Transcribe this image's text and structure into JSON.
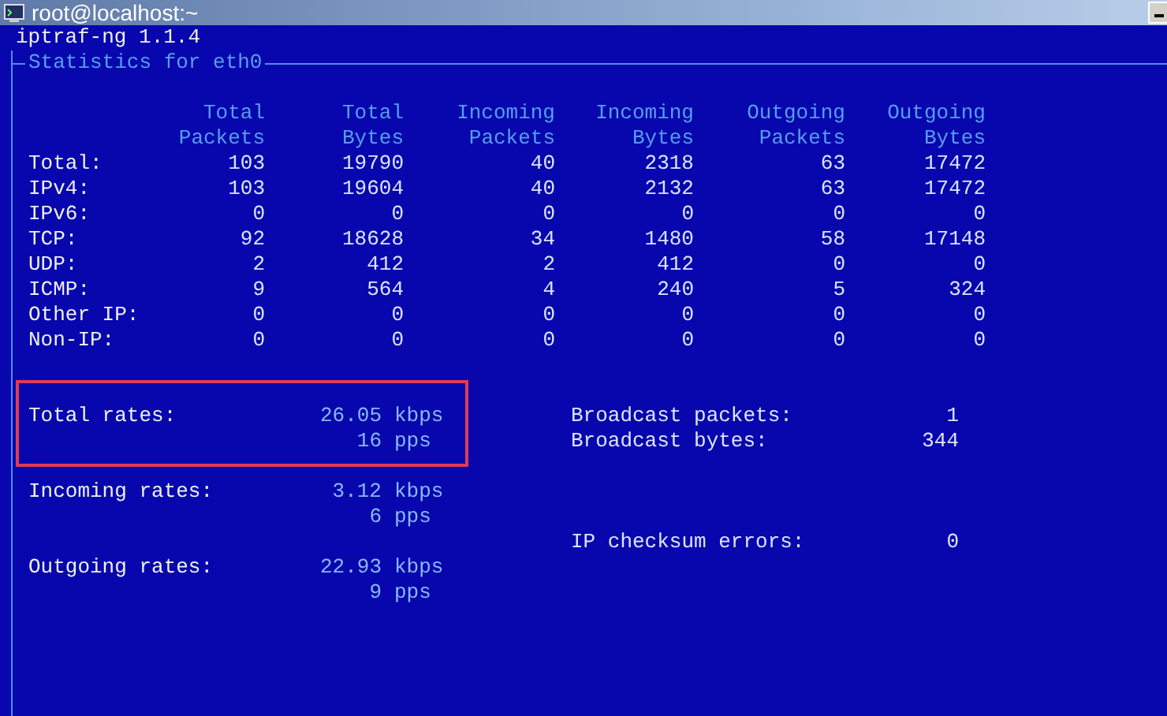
{
  "window": {
    "title": "root@localhost:~"
  },
  "terminal": {
    "app_title": "iptraf-ng 1.1.4",
    "panel_title": "Statistics for eth0",
    "table": {
      "columns": [
        "Total Packets",
        "Total Bytes",
        "Incoming Packets",
        "Incoming Bytes",
        "Outgoing Packets",
        "Outgoing Bytes"
      ],
      "rows": [
        {
          "label": "Total:",
          "cells": [
            "103",
            "19790",
            "40",
            "2318",
            "63",
            "17472"
          ]
        },
        {
          "label": "IPv4:",
          "cells": [
            "103",
            "19604",
            "40",
            "2132",
            "63",
            "17472"
          ]
        },
        {
          "label": "IPv6:",
          "cells": [
            "0",
            "0",
            "0",
            "0",
            "0",
            "0"
          ]
        },
        {
          "label": "TCP:",
          "cells": [
            "92",
            "18628",
            "34",
            "1480",
            "58",
            "17148"
          ]
        },
        {
          "label": "UDP:",
          "cells": [
            "2",
            "412",
            "2",
            "412",
            "0",
            "0"
          ]
        },
        {
          "label": "ICMP:",
          "cells": [
            "9",
            "564",
            "4",
            "240",
            "5",
            "324"
          ]
        },
        {
          "label": "Other IP:",
          "cells": [
            "0",
            "0",
            "0",
            "0",
            "0",
            "0"
          ]
        },
        {
          "label": "Non-IP:",
          "cells": [
            "0",
            "0",
            "0",
            "0",
            "0",
            "0"
          ]
        }
      ]
    },
    "rates": [
      {
        "label": "Total rates:",
        "highlighted": true,
        "lines": [
          {
            "value": "26.05",
            "unit": "kbps"
          },
          {
            "value": "16",
            "unit": "pps"
          }
        ]
      },
      {
        "label": "Incoming rates:",
        "highlighted": false,
        "lines": [
          {
            "value": "3.12",
            "unit": "kbps"
          },
          {
            "value": "6",
            "unit": "pps"
          }
        ]
      },
      {
        "label": "Outgoing rates:",
        "highlighted": false,
        "lines": [
          {
            "value": "22.93",
            "unit": "kbps"
          },
          {
            "value": "9",
            "unit": "pps"
          }
        ]
      }
    ],
    "counter_groups": [
      [
        {
          "label": "Broadcast packets:",
          "value": "1"
        },
        {
          "label": "Broadcast bytes:",
          "value": "344"
        }
      ],
      [
        {
          "label": "IP checksum errors:",
          "value": "0"
        }
      ]
    ]
  }
}
